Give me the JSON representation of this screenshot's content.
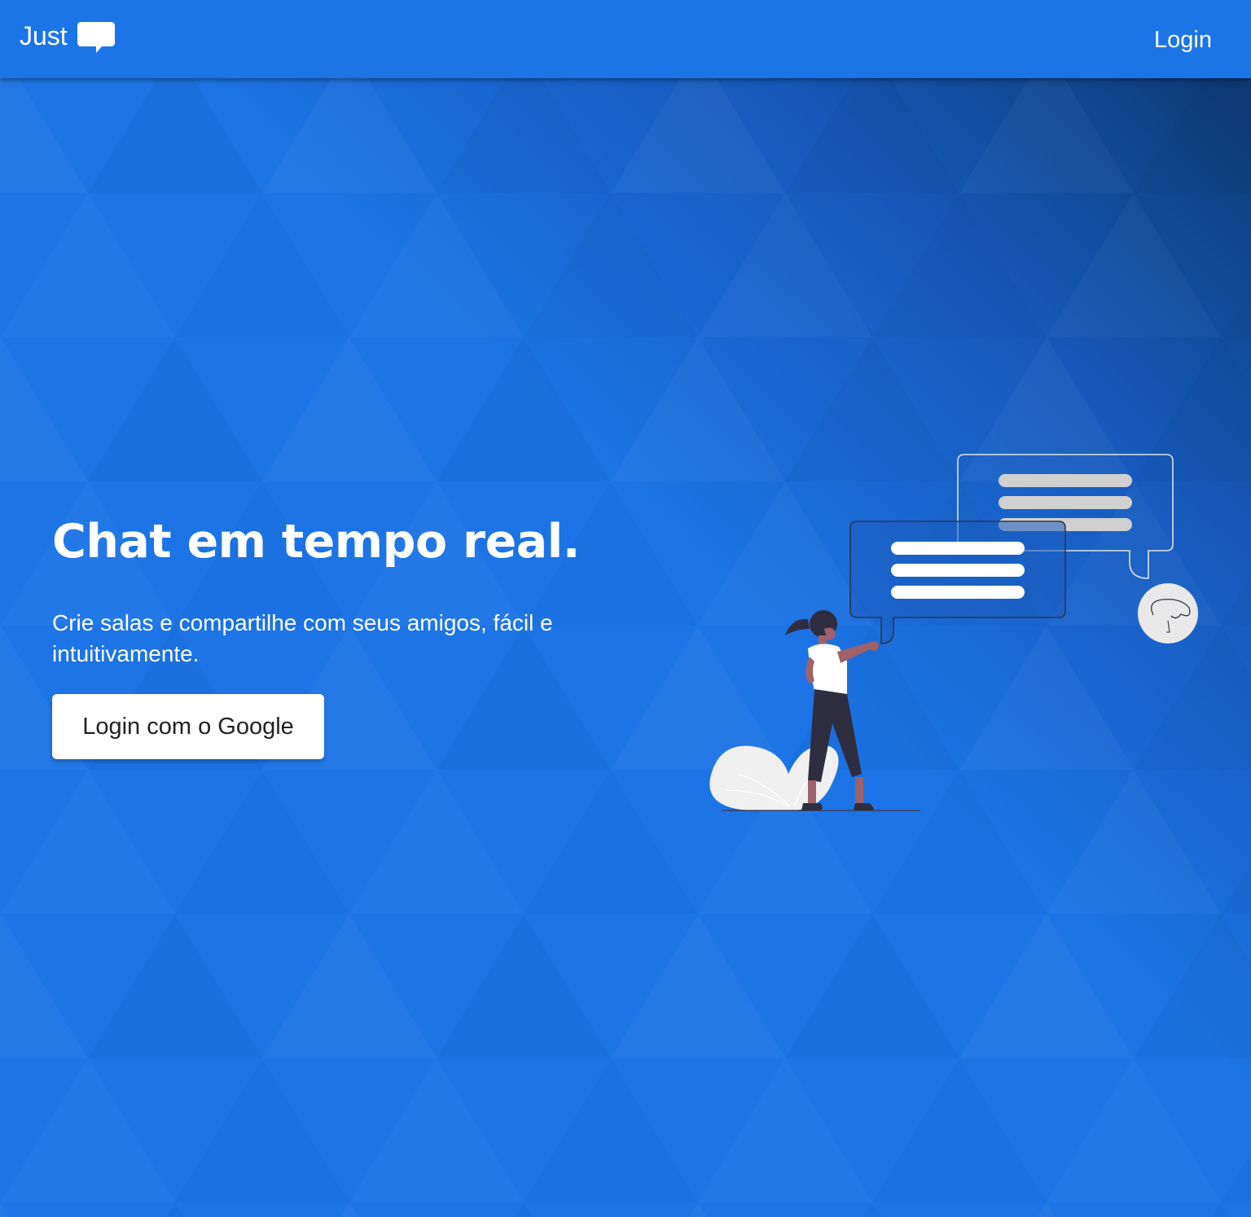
{
  "appbar": {
    "brand_text": "Just",
    "brand_icon": "chat-bubble-icon",
    "login_label": "Login"
  },
  "hero": {
    "title": "Chat em tempo real.",
    "subtitle": "Crie salas e compartilhe com seus amigos, fácil e intuitivamente.",
    "google_button_label": "Login com o Google"
  },
  "illustration": {
    "name": "person-chatting-illustration"
  },
  "colors": {
    "primary": "#1c75e7",
    "background_dark": "#0d3c78",
    "button_bg": "#ffffff",
    "button_text": "#222222",
    "text_light": "#ffffff"
  }
}
